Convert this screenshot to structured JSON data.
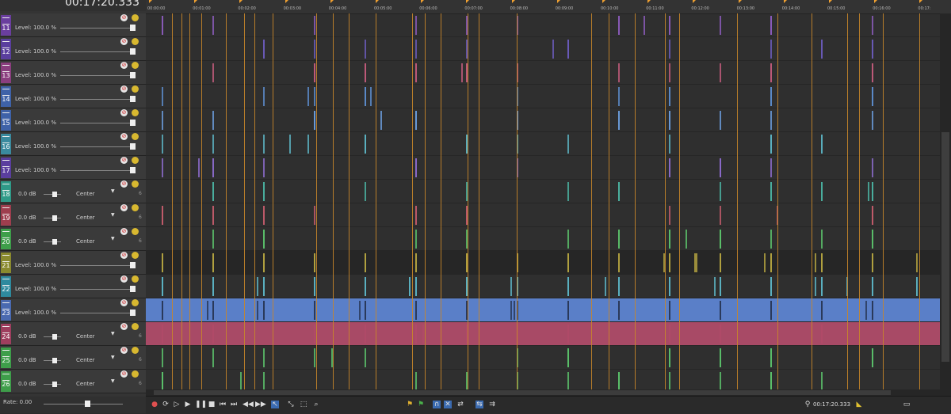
{
  "header": {
    "timecode": "00:17:20.333"
  },
  "ruler": {
    "labels": [
      "00:00:00",
      "00:01:00",
      "00:02:00",
      "00:03:00",
      "00:04:00",
      "00:05:00",
      "00:06:00",
      "00:07:00",
      "00:08:00",
      "00:09:00",
      "00:10:00",
      "00:11:00",
      "00:12:00",
      "00:13:00",
      "00:14:00",
      "00:15:00",
      "00:16:00",
      "00:17:"
    ]
  },
  "tracks": [
    {
      "num": "11",
      "type": "video",
      "color": "#6a3e9e",
      "level": "Level: 100.0 %"
    },
    {
      "num": "12",
      "type": "video",
      "color": "#5a3e9e",
      "level": "Level: 100.0 %"
    },
    {
      "num": "13",
      "type": "video",
      "color": "#8a3e7e",
      "level": "Level: 100.0 %"
    },
    {
      "num": "14",
      "type": "video",
      "color": "#3e62a8",
      "level": "Level: 100.0 %"
    },
    {
      "num": "15",
      "type": "video",
      "color": "#3e62a8",
      "level": "Level: 100.0 %"
    },
    {
      "num": "16",
      "type": "video",
      "color": "#3a8a9e",
      "level": "Level: 100.0 %"
    },
    {
      "num": "17",
      "type": "video",
      "color": "#5a3e9e",
      "level": "Level: 100.0 %"
    },
    {
      "num": "18",
      "type": "audio",
      "color": "#2f9a88",
      "db": "0.0 dB",
      "pan": "Center"
    },
    {
      "num": "19",
      "type": "audio",
      "color": "#9e3e4e",
      "db": "0.0 dB",
      "pan": "Center"
    },
    {
      "num": "20",
      "type": "audio",
      "color": "#3e9e4a",
      "db": "0.0 dB",
      "pan": "Center"
    },
    {
      "num": "21",
      "type": "video",
      "color": "#8a8a2e",
      "level": "Level: 100.0 %"
    },
    {
      "num": "22",
      "type": "video",
      "color": "#2e8a9e",
      "level": "Level: 100.0 %"
    },
    {
      "num": "23",
      "type": "video",
      "color": "#4a6ab0",
      "level": "Level: 100.0 %"
    },
    {
      "num": "24",
      "type": "audio",
      "color": "#9e3e5e",
      "db": "0.0 dB",
      "pan": "Center"
    },
    {
      "num": "25",
      "type": "audio",
      "color": "#3e9e4a",
      "db": "0.0 dB",
      "pan": "Center"
    },
    {
      "num": "26",
      "type": "audio",
      "color": "#3e9e4a",
      "db": "0.0 dB",
      "pan": "Center"
    }
  ],
  "rate": {
    "label": "Rate: 0.00"
  },
  "transport": {
    "timecode": "00:17:20.333"
  },
  "colors": {
    "accent_line": "#c8862a",
    "marker": "#f0a030",
    "blue_track": "#5a7fc8",
    "pink_track": "#b04a68"
  },
  "icons": [
    "mute-icon",
    "solo-icon",
    "record-icon",
    "loop-icon",
    "play-icon",
    "pause-icon",
    "stop-icon",
    "prev-icon",
    "next-icon"
  ]
}
